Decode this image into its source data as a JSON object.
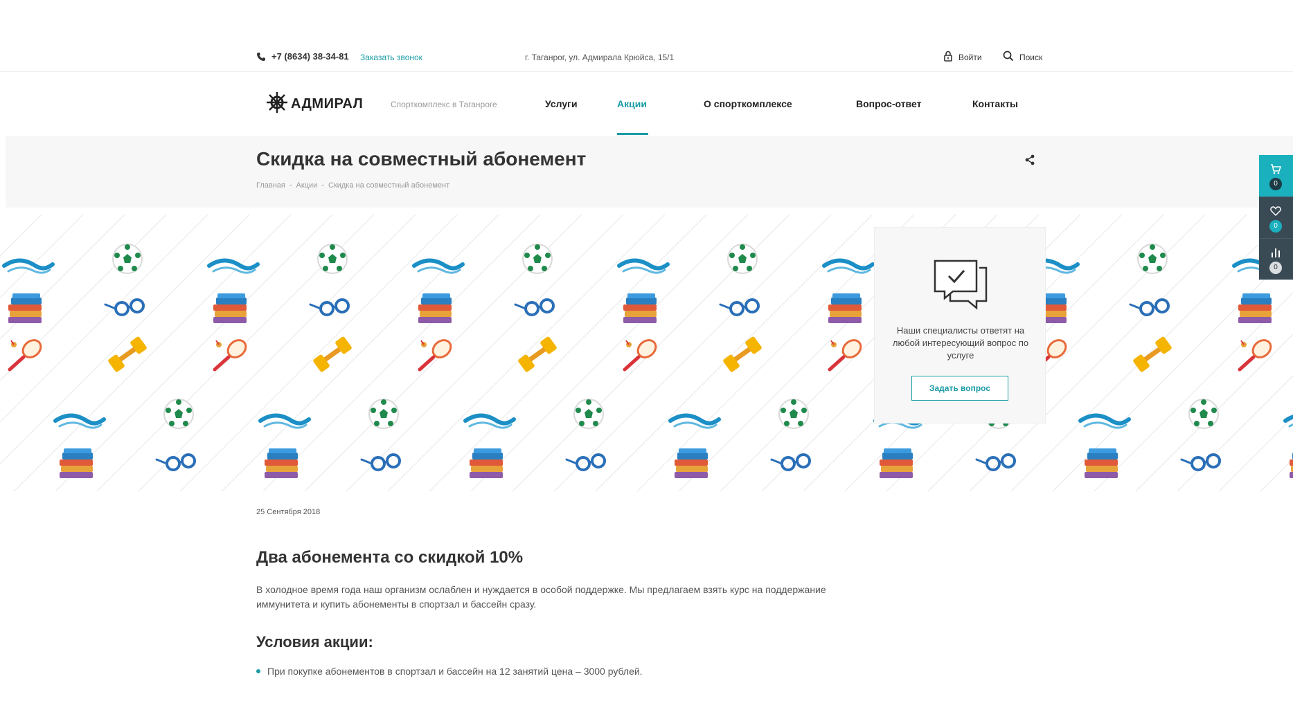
{
  "topbar": {
    "phone": "+7 (8634) 38-34-81",
    "callback": "Заказать звонок",
    "address": "г. Таганрог, ул. Адмирала Крюйса, 15/1",
    "login": "Войти",
    "search": "Поиск"
  },
  "header": {
    "logo": "АДМИРАЛ",
    "tagline": "Спорткомплекс в Таганроге",
    "nav": [
      "Услуги",
      "Акции",
      "О спорткомплексе",
      "Вопрос-ответ",
      "Контакты"
    ],
    "active_nav": "Акции"
  },
  "page": {
    "title": "Скидка на совместный абонемент",
    "breadcrumb": [
      "Главная",
      "-",
      "Акции",
      "-",
      "Скидка на совместный абонемент"
    ]
  },
  "question_card": {
    "text": "Наши специалисты ответят на любой интересующий вопрос по услуге",
    "button": "Задать вопрос"
  },
  "side_panel": {
    "cart_count": "0",
    "favorites_count": "0",
    "compare_count": "0"
  },
  "content": {
    "date": "25 Сентября 2018",
    "heading": "Два абонемента со скидкой 10%",
    "paragraph": "В холодное время года наш организм ослаблен и нуждается в особой поддержке. Мы предлагаем взять курс на поддержание иммунитета и купить абонементы в спортзал и бассейн сразу.",
    "conditions_heading": "Условия акции:",
    "conditions": [
      "При покупке абонементов в спортзал и бассейн на 12 занятий цена – 3000 рублей."
    ]
  },
  "colors": {
    "accent": "#1a9ba6",
    "side_cart": "#1ab0bd",
    "side_dark": "#3a4a55"
  }
}
